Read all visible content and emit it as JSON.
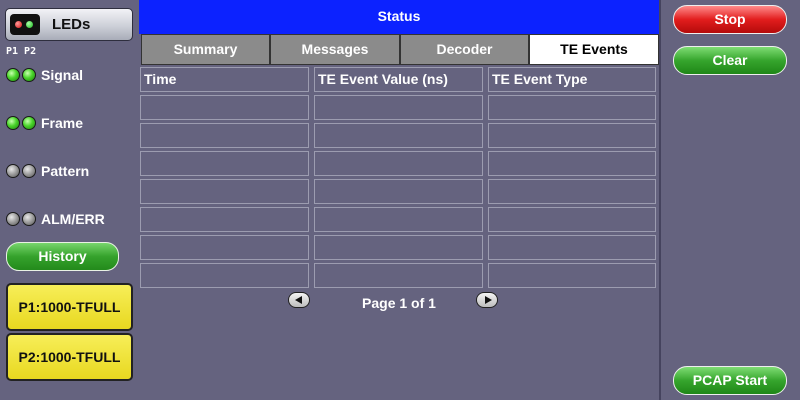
{
  "left": {
    "leds_button": {
      "label": "LEDs"
    },
    "port_header": "P1 P2",
    "indicators": [
      {
        "label": "Signal",
        "p1": "green",
        "p2": "green"
      },
      {
        "label": "Frame",
        "p1": "green",
        "p2": "green"
      },
      {
        "label": "Pattern",
        "p1": "off",
        "p2": "off"
      },
      {
        "label": "ALM/ERR",
        "p1": "off",
        "p2": "off"
      }
    ],
    "history_label": "History",
    "port1_label": "P1:1000-TFULL",
    "port2_label": "P2:1000-TFULL"
  },
  "center": {
    "title": "Status",
    "tabs": [
      {
        "label": "Summary",
        "active": false
      },
      {
        "label": "Messages",
        "active": false
      },
      {
        "label": "Decoder",
        "active": false
      },
      {
        "label": "TE Events",
        "active": true
      }
    ],
    "table": {
      "columns": [
        "Time",
        "TE Event Value (ns)",
        "TE Event Type"
      ],
      "rows": [
        [
          "",
          "",
          ""
        ],
        [
          "",
          "",
          ""
        ],
        [
          "",
          "",
          ""
        ],
        [
          "",
          "",
          ""
        ],
        [
          "",
          "",
          ""
        ],
        [
          "",
          "",
          ""
        ],
        [
          "",
          "",
          ""
        ]
      ]
    },
    "pager": {
      "label": "Page 1 of 1"
    }
  },
  "right": {
    "stop_label": "Stop",
    "clear_label": "Clear",
    "pcap_label": "PCAP Start"
  },
  "colors": {
    "background": "#65637f",
    "title_bar": "#0c22ff",
    "stop": "#e21d1d",
    "green_button": "#36a52d",
    "port_button": "#f0e23a",
    "led_on": "#49d42a",
    "led_off": "#9a9a9a"
  },
  "icons": {
    "leds": "leds-status-icon",
    "prev": "page-prev-arrow-icon",
    "next": "page-next-arrow-icon"
  }
}
